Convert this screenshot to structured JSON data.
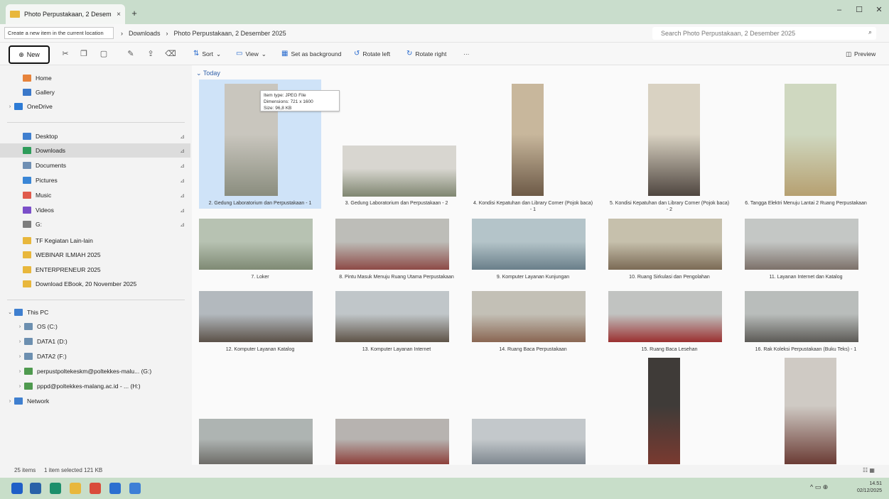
{
  "window": {
    "tab_title": "Photo Perpustakaan, 2 Desem",
    "tab_close": "×",
    "new_tab": "+",
    "minimize": "–",
    "maximize": "☐",
    "close": "✕"
  },
  "address": {
    "tooltip": "Create a new item in the current location",
    "crumbs": [
      "Downloads",
      "Photo Perpustakaan, 2 Desember 2025"
    ],
    "separator": "›",
    "search_placeholder": "Search Photo Perpustakaan, 2 Desember 2025"
  },
  "toolbar": {
    "new_label": "New",
    "sort_label": "Sort",
    "view_label": "View",
    "set_background": "Set as background",
    "rotate_left": "Rotate left",
    "rotate_right": "Rotate right",
    "more": "···",
    "preview": "Preview"
  },
  "sidebar": {
    "top": [
      {
        "label": "Home",
        "color": "#e7833b"
      },
      {
        "label": "Gallery",
        "color": "#3a78c9"
      },
      {
        "label": "OneDrive",
        "color": "#2d7bd5"
      }
    ],
    "pinned": [
      {
        "label": "Desktop",
        "color": "#3f7fcf"
      },
      {
        "label": "Downloads",
        "color": "#2e9c5a"
      },
      {
        "label": "Documents",
        "color": "#6f8fb3"
      },
      {
        "label": "Pictures",
        "color": "#3a86d6"
      },
      {
        "label": "Music",
        "color": "#e05a4c"
      },
      {
        "label": "Videos",
        "color": "#7b4fc9"
      },
      {
        "label": "G:",
        "color": "#7d7d7d"
      }
    ],
    "folders": [
      {
        "label": "TF Kegiatan Lain-lain",
        "color": "#e8b73c"
      },
      {
        "label": "WEBINAR ILMIAH 2025",
        "color": "#e8b73c"
      },
      {
        "label": "ENTERPRENEUR 2025",
        "color": "#e8b73c"
      },
      {
        "label": "Download EBook, 20 November 2025",
        "color": "#e8b73c"
      }
    ],
    "drives": [
      {
        "label": "This PC",
        "color": "#3f7fcf"
      },
      {
        "label": "OS (C:)",
        "color": "#6c8fb0"
      },
      {
        "label": "DATA1 (D:)",
        "color": "#6c8fb0"
      },
      {
        "label": "DATA2 (F:)",
        "color": "#6c8fb0"
      },
      {
        "label": "perpustpoltekeskm@poltekkes-malu... (G:)",
        "color": "#4f9a4f"
      },
      {
        "label": "pppd@poltekkes-malang.ac.id - ... (H:)",
        "color": "#4f9a4f"
      },
      {
        "label": "Network",
        "color": "#3f7fcf"
      }
    ],
    "pin_glyph": "⊿"
  },
  "content": {
    "group": "Today",
    "tooltip_lines": [
      "Item type: JPEG File",
      "Dimensions: 721 x 1600",
      "Size: 96,8 KB"
    ],
    "items": [
      {
        "caption": "2. Gedung Laboratorium dan Perpustakaan - 1",
        "c1": "#c9c6be",
        "c2": "#8a8d7e"
      },
      {
        "caption": "3. Gedung Laboratorium dan Perpustakaan - 2",
        "c1": "#d8d6d0",
        "c2": "#7f8670"
      },
      {
        "caption": "4. Kondisi Kepatuhan dan Library Corner (Pojok baca) - 1",
        "c1": "#c8b79c",
        "c2": "#6d5a47"
      },
      {
        "caption": "5. Kondisi Kepatuhan dan Library Corner (Pojok baca) - 2",
        "c1": "#d9d2c2",
        "c2": "#4f4640"
      },
      {
        "caption": "6. Tangga Elektri Menuju Lantai 2 Ruang Perpustakaan",
        "c1": "#cfd8c0",
        "c2": "#b6a071"
      },
      {
        "caption": "7. Loker",
        "c1": "#b7c2b2",
        "c2": "#7f8a74"
      },
      {
        "caption": "8. Pintu Masuk Menuju Ruang Utama Perpustakaan",
        "c1": "#bdbdb8",
        "c2": "#8d4a46"
      },
      {
        "caption": "9. Komputer Layanan Kunjungan",
        "c1": "#b4c4c9",
        "c2": "#6a7f8a"
      },
      {
        "caption": "10. Ruang Sirkulasi dan Pengolahan",
        "c1": "#c6c0ac",
        "c2": "#7b6a55"
      },
      {
        "caption": "11. Layanan Internet dan Katalog",
        "c1": "#c4c7c5",
        "c2": "#7c7069"
      },
      {
        "caption": "12. Komputer Layanan Katalog",
        "c1": "#b3b9be",
        "c2": "#5b5148"
      },
      {
        "caption": "13. Komputer Layanan Internet",
        "c1": "#c0c6c9",
        "c2": "#5e5347"
      },
      {
        "caption": "14. Ruang Baca Perpustakaan",
        "c1": "#c3c0b6",
        "c2": "#8a6652"
      },
      {
        "caption": "15. Ruang Baca Lesehan",
        "c1": "#c1c3c1",
        "c2": "#9b3030"
      },
      {
        "caption": "16. Rak Koleksi Perpustakaan (Buku Teks) - 1",
        "c1": "#b9bdbb",
        "c2": "#5c5a56"
      },
      {
        "caption": "",
        "c1": "#aeb4b2",
        "c2": "#6e6c68"
      },
      {
        "caption": "",
        "c1": "#b7b3b0",
        "c2": "#8d3f3a"
      },
      {
        "caption": "",
        "c1": "#c3c8cb",
        "c2": "#7f8890"
      },
      {
        "caption": "",
        "c1": "#3f3b38",
        "c2": "#7a3a30"
      },
      {
        "caption": "",
        "c1": "#cfcac4",
        "c2": "#6b3c35"
      }
    ]
  },
  "status": {
    "count": "25 items",
    "selected": "1 item selected  121 KB",
    "view_icons": "☷ ▦"
  },
  "taskbar": {
    "apps": [
      {
        "name": "start",
        "color": "#1f5fc7"
      },
      {
        "name": "photos",
        "color": "#2a62a8"
      },
      {
        "name": "edge",
        "color": "#1c8f6b"
      },
      {
        "name": "explorer",
        "color": "#e8b73c"
      },
      {
        "name": "chrome",
        "color": "#d94c3b"
      },
      {
        "name": "word",
        "color": "#2b6fd0"
      },
      {
        "name": "store",
        "color": "#3d7fd6"
      }
    ],
    "tray": "^  ▭ ⊕",
    "time": "14.51",
    "date": "02/12/2025"
  }
}
